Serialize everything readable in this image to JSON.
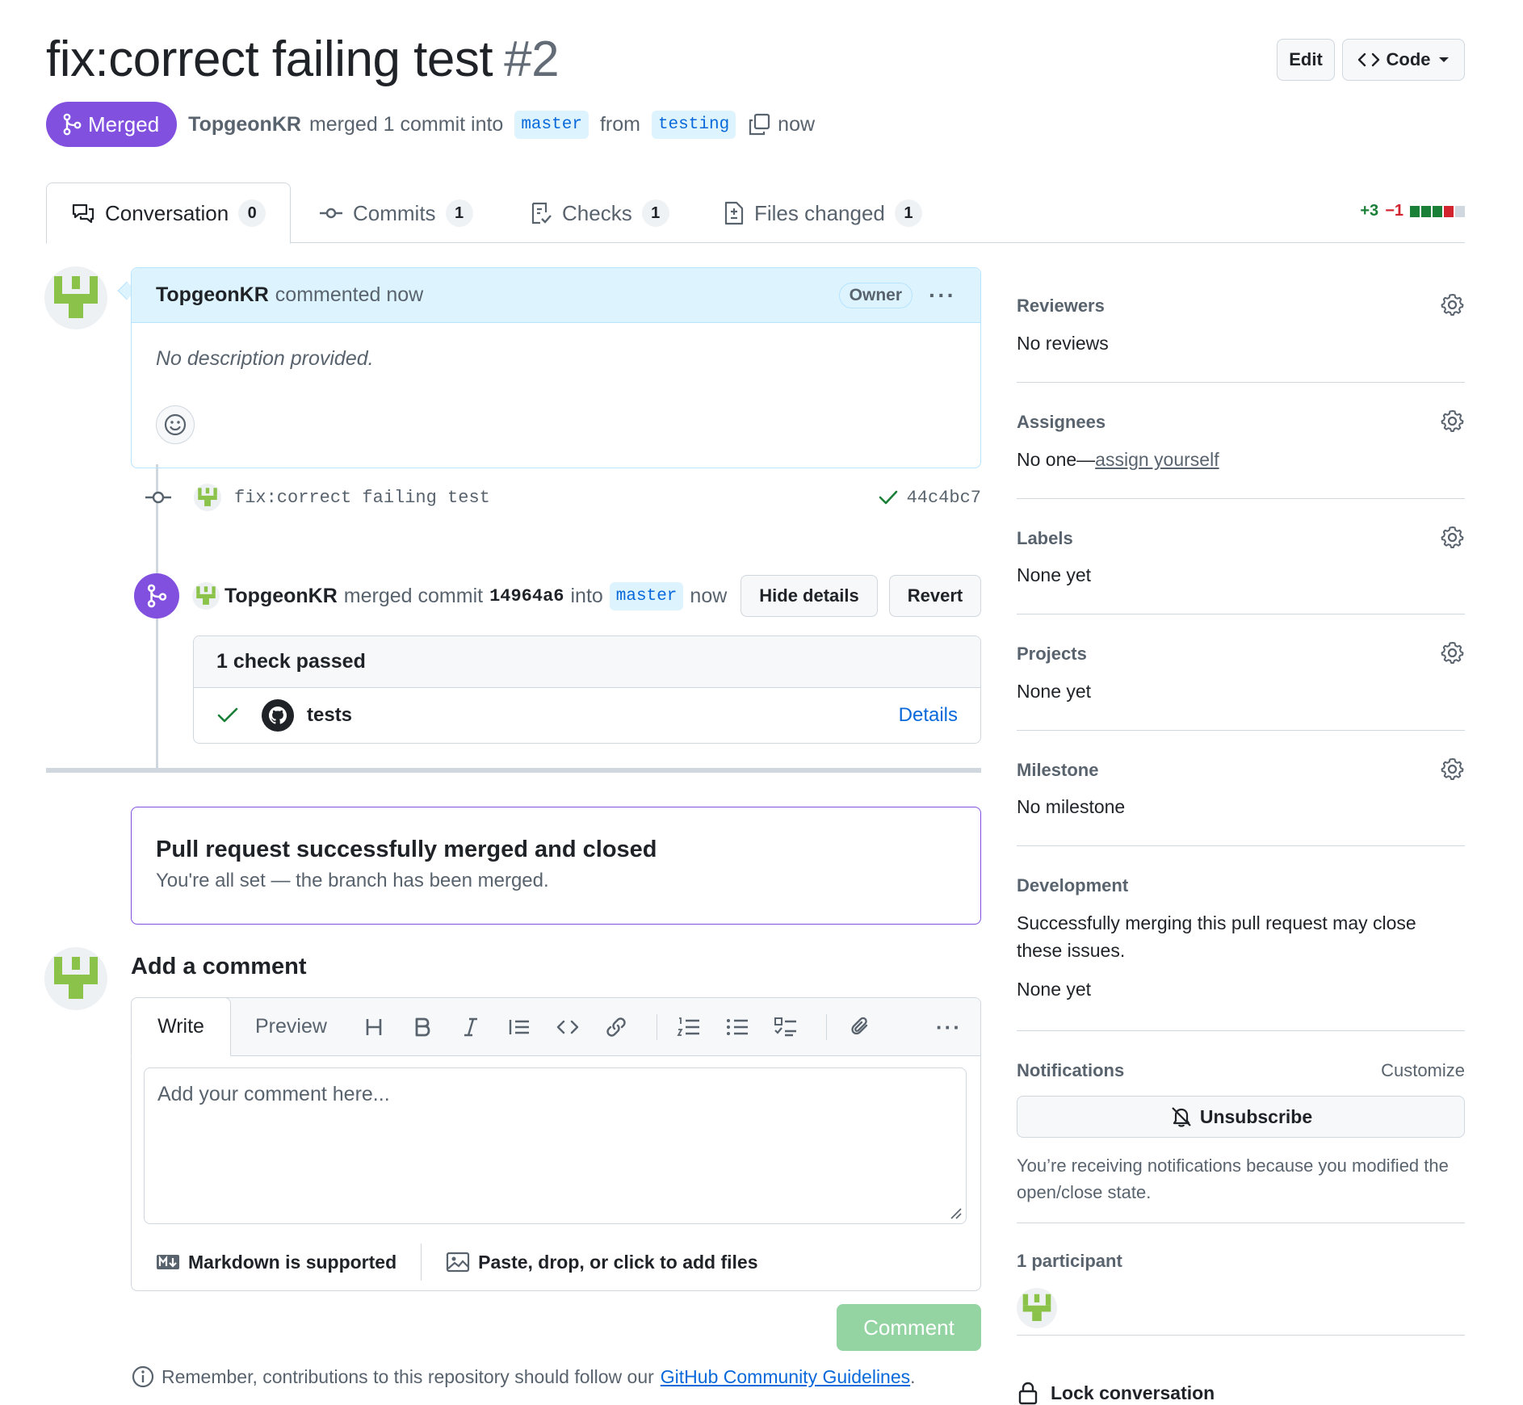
{
  "header": {
    "title": "fix:correct failing test",
    "number": "#2",
    "edit_label": "Edit",
    "code_label": "Code"
  },
  "state": {
    "badge": "Merged",
    "author": "TopgeonKR",
    "merged_text": "merged 1 commit into",
    "base_branch": "master",
    "from_text": "from",
    "head_branch": "testing",
    "time": "now"
  },
  "tabs": [
    {
      "label": "Conversation",
      "count": "0"
    },
    {
      "label": "Commits",
      "count": "1"
    },
    {
      "label": "Checks",
      "count": "1"
    },
    {
      "label": "Files changed",
      "count": "1"
    }
  ],
  "diffstat": {
    "additions": "+3",
    "deletions": "−1"
  },
  "comment": {
    "author": "TopgeonKR",
    "action": "commented now",
    "role": "Owner",
    "body": "No description provided."
  },
  "commit": {
    "message": "fix:correct failing test",
    "sha": "44c4bc7"
  },
  "merge_event": {
    "author": "TopgeonKR",
    "text1": "merged commit",
    "sha": "14964a6",
    "text2": "into",
    "branch": "master",
    "time": "now",
    "hide_label": "Hide details",
    "revert_label": "Revert"
  },
  "checks": {
    "header": "1 check passed",
    "name": "tests",
    "details_label": "Details"
  },
  "merged_box": {
    "title": "Pull request successfully merged and closed",
    "subtitle": "You're all set — the branch has been merged."
  },
  "add_comment": {
    "title": "Add a comment",
    "write_tab": "Write",
    "preview_tab": "Preview",
    "placeholder": "Add your comment here...",
    "markdown_label": "Markdown is supported",
    "paste_label": "Paste, drop, or click to add files",
    "submit_label": "Comment",
    "remember_prefix": "Remember, contributions to this repository should follow our",
    "remember_link": "GitHub Community Guidelines",
    "remember_suffix": "."
  },
  "sidebar": {
    "reviewers": {
      "title": "Reviewers",
      "value": "No reviews"
    },
    "assignees": {
      "title": "Assignees",
      "value_prefix": "No one—",
      "value_link": "assign yourself"
    },
    "labels": {
      "title": "Labels",
      "value": "None yet"
    },
    "projects": {
      "title": "Projects",
      "value": "None yet"
    },
    "milestone": {
      "title": "Milestone",
      "value": "No milestone"
    },
    "development": {
      "title": "Development",
      "text": "Successfully merging this pull request may close these issues.",
      "value": "None yet"
    },
    "notifications": {
      "title": "Notifications",
      "customize": "Customize",
      "button": "Unsubscribe",
      "note": "You’re receiving notifications because you modified the open/close state."
    },
    "participants": {
      "title": "1 participant"
    },
    "lock": {
      "label": "Lock conversation"
    }
  },
  "colors": {
    "merged": "#8250df",
    "link": "#0969da",
    "success": "#1a7f37",
    "danger": "#d1242f",
    "avatar": "#8bc34a"
  }
}
